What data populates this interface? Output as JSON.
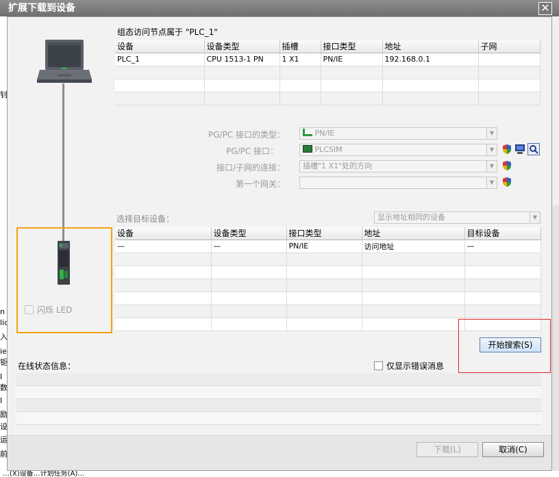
{
  "window": {
    "title": "扩展下载到设备",
    "close_glyph": "✕"
  },
  "config_access": {
    "title": "组态访问节点属于 \"PLC_1\"",
    "columns": [
      "设备",
      "设备类型",
      "插槽",
      "接口类型",
      "地址",
      "子网"
    ],
    "rows": [
      [
        "PLC_1",
        "CPU 1513-1 PN",
        "1 X1",
        "PN/IE",
        "192.168.0.1",
        ""
      ],
      [
        "",
        "",
        "",
        "",
        "",
        ""
      ],
      [
        "",
        "",
        "",
        "",
        "",
        ""
      ],
      [
        "",
        "",
        "",
        "",
        "",
        ""
      ]
    ]
  },
  "pgpc": {
    "interface_type_label": "PG/PC 接口的类型：",
    "interface_type_value": "PN/IE",
    "interface_label": "PG/PC 接口：",
    "interface_value": "PLCSIM",
    "subnet_conn_label": "接口/子网的连接：",
    "subnet_conn_value": "插槽\"1 X1\"处的方向",
    "gateway_label": "第一个网关：",
    "gateway_value": ""
  },
  "target": {
    "label": "选择目标设备：",
    "filter_value": "显示地址相同的设备",
    "columns": [
      "设备",
      "设备类型",
      "接口类型",
      "地址",
      "目标设备"
    ],
    "rows": [
      [
        "—",
        "—",
        "PN/IE",
        "访问地址",
        "—"
      ],
      [
        "",
        "",
        "",
        "",
        ""
      ],
      [
        "",
        "",
        "",
        "",
        ""
      ],
      [
        "",
        "",
        "",
        "",
        ""
      ],
      [
        "",
        "",
        "",
        "",
        ""
      ],
      [
        "",
        "",
        "",
        "",
        ""
      ],
      [
        "",
        "",
        "",
        "",
        ""
      ]
    ]
  },
  "led": {
    "label": "闪烁 LED"
  },
  "search_button": "开始搜索(S)",
  "status": {
    "label": "在线状态信息：",
    "errors_only_label": "仅显示错误消息"
  },
  "footer": {
    "download_button": "下载(L)",
    "cancel_button": "取消(C)"
  },
  "background_fragments": {
    "left": [
      "钊",
      "n",
      "lic",
      "入技",
      "ie",
      "钜",
      "I",
      "数",
      "I",
      "励",
      "设",
      "运",
      "前"
    ],
    "bottom": "…(X)设备…计划任务(A)…"
  }
}
